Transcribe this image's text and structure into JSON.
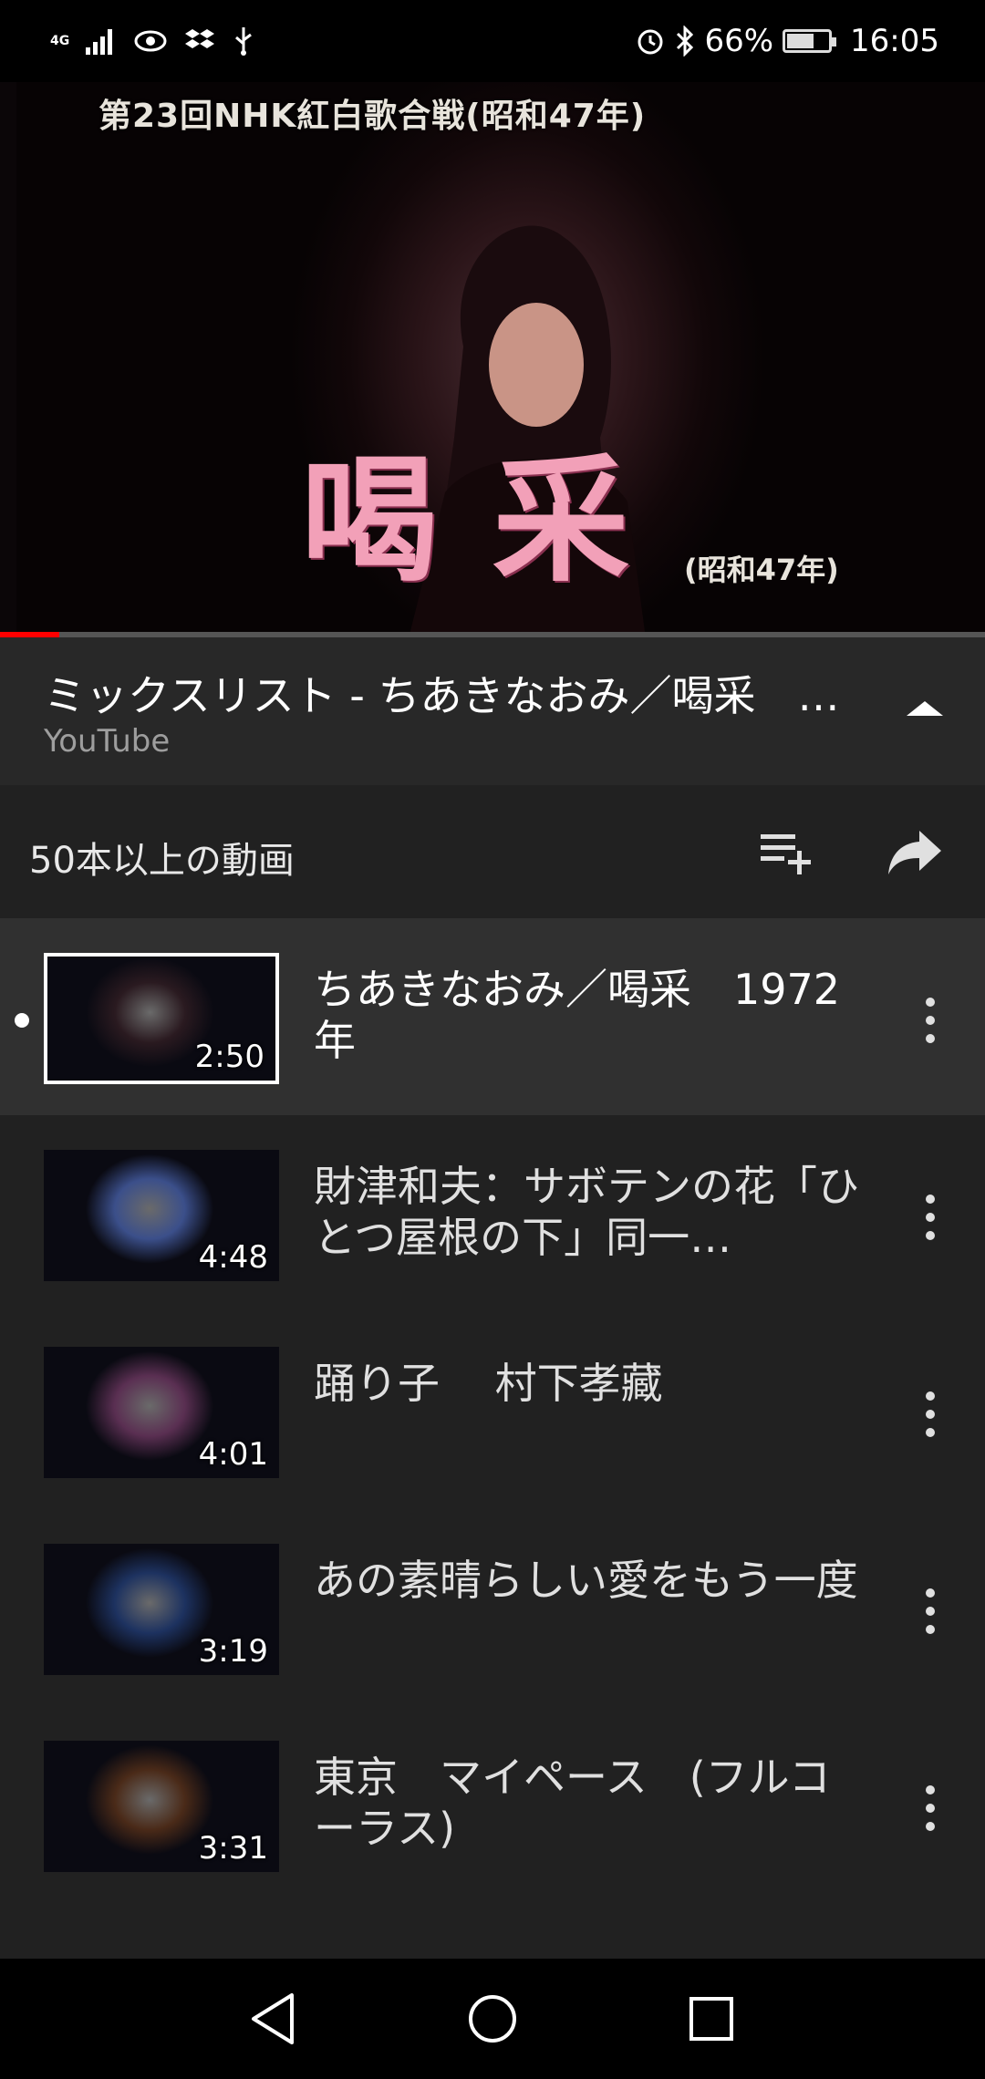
{
  "status_bar": {
    "network": "4G",
    "battery": "66%",
    "time": "16:05"
  },
  "video": {
    "overlay_top": "第23回NHK紅白歌合戦(昭和47年)",
    "overlay_title": "喝采",
    "overlay_year": "(昭和47年)",
    "progress": 0.06
  },
  "now_playing": {
    "title": "ミックスリスト - ちあきなおみ／喝采　…",
    "subtitle": "YouTube"
  },
  "playlist_header": {
    "count_label": "50本以上の動画"
  },
  "items": [
    {
      "title": "ちあきなおみ／喝采　1972年",
      "duration": "2:50",
      "active": true,
      "color": "#2a1a20"
    },
    {
      "title": "財津和夫：サボテンの花「ひとつ屋根の下」同一…",
      "duration": "4:48",
      "active": false,
      "color": "#3b4f8a"
    },
    {
      "title": "踊り子　 村下孝藏",
      "duration": "4:01",
      "active": false,
      "color": "#5a2f52"
    },
    {
      "title": "あの素晴らしい愛をもう一度",
      "duration": "3:19",
      "active": false,
      "color": "#1d3260"
    },
    {
      "title": "東京　マイペース　(フルコーラス)",
      "duration": "3:31",
      "active": false,
      "color": "#4a2a18"
    }
  ]
}
